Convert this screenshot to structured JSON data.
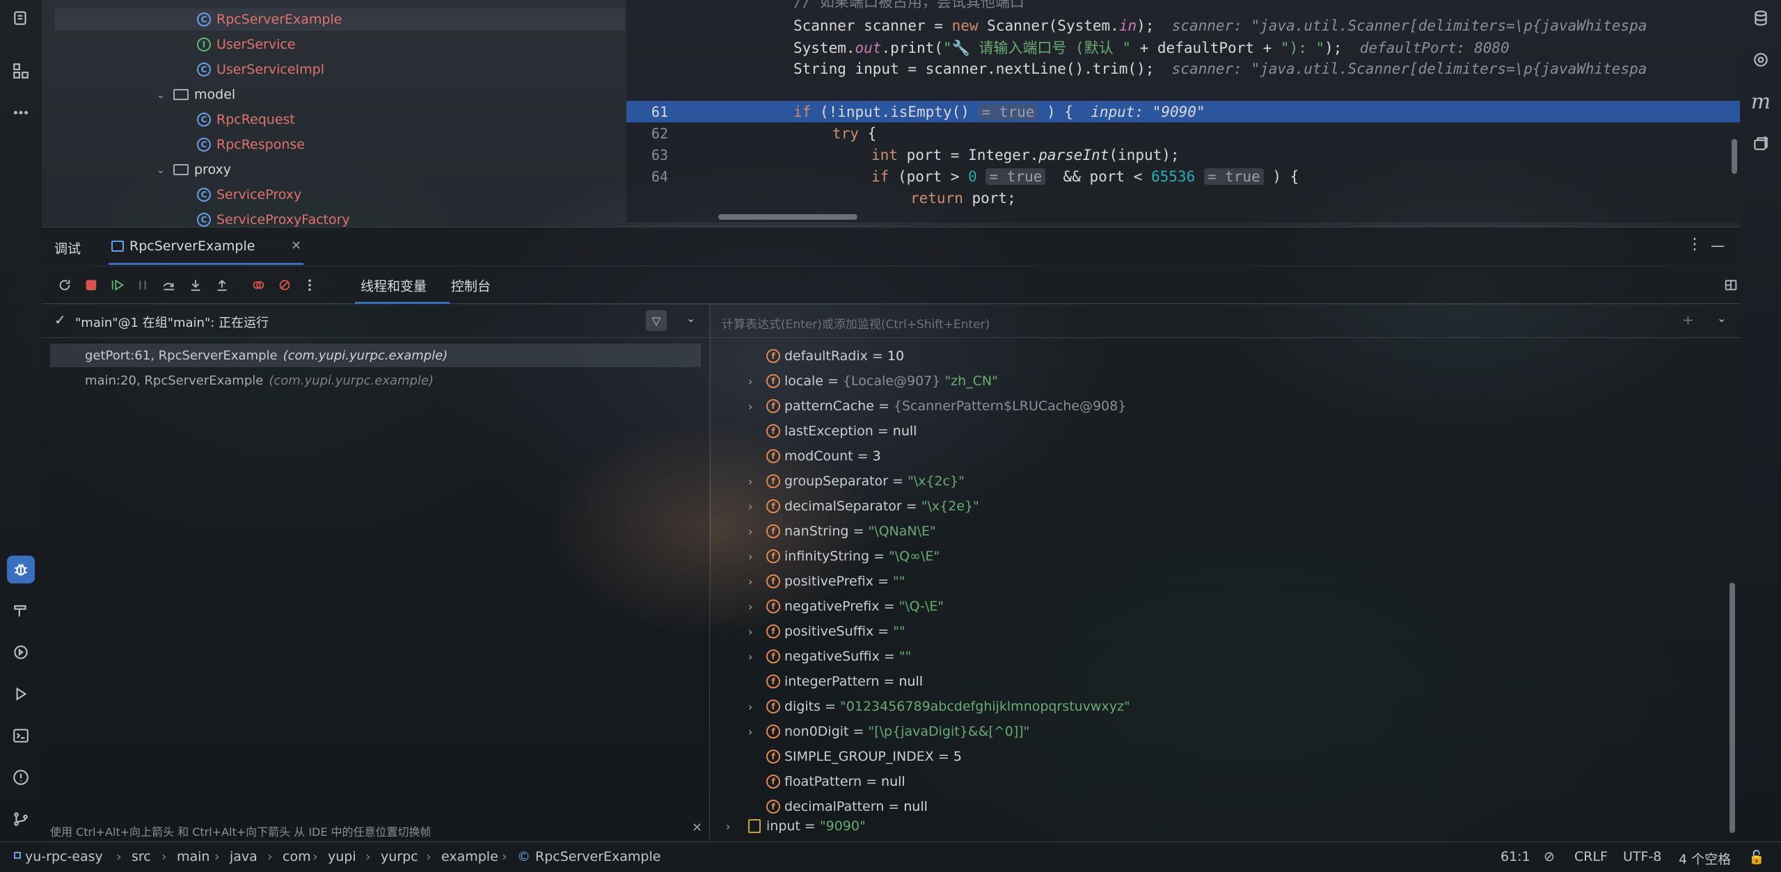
{
  "project_tree": {
    "items": [
      {
        "label": "RpcServerExample",
        "kind": "class",
        "color": "red",
        "selected": true
      },
      {
        "label": "UserService",
        "kind": "interface",
        "color": "red"
      },
      {
        "label": "UserServiceImpl",
        "kind": "class",
        "color": "red"
      },
      {
        "label": "model",
        "kind": "package"
      },
      {
        "label": "RpcRequest",
        "kind": "class",
        "color": "red"
      },
      {
        "label": "RpcResponse",
        "kind": "class",
        "color": "red"
      },
      {
        "label": "proxy",
        "kind": "package"
      },
      {
        "label": "ServiceProxy",
        "kind": "class",
        "color": "red"
      },
      {
        "label": "ServiceProxyFactory",
        "kind": "class",
        "color": "red"
      }
    ]
  },
  "editor": {
    "comment_top": "// 如果端口被占用，尝试其他端口",
    "lines": [
      {
        "num": "",
        "code": "Scanner scanner = new Scanner(System.in);",
        "inlay": "scanner: \"java.util.Scanner[delimiters=\\p{javaWhitespa"
      },
      {
        "num": "",
        "code": "System.out.print(\"🔧 请输入端口号 (默认 \" + defaultPort + \"): \");",
        "inlay": "defaultPort: 8080"
      },
      {
        "num": "",
        "code": "String input = scanner.nextLine().trim();",
        "inlay": "scanner: \"java.util.Scanner[delimiters=\\p{javaWhitespa"
      },
      {
        "num": "61",
        "code": "if (!input.isEmpty()",
        "box": "= true",
        "code2": ") {",
        "inlay": "input: \"9090\""
      },
      {
        "num": "62",
        "code": "try {"
      },
      {
        "num": "63",
        "code": "int port = Integer.parseInt(input);"
      },
      {
        "num": "64",
        "code": "if (port > 0",
        "box": "= true",
        "code2": "&& port < 65536",
        "box2": "= true",
        "code3": ") {"
      },
      {
        "num": "",
        "code": "return port;"
      }
    ]
  },
  "debug": {
    "tab_debug": "调试",
    "tab_config": "RpcServerExample",
    "tab_threads": "线程和变量",
    "tab_console": "控制台",
    "thread_status": "\"main\"@1 在组\"main\": 正在运行",
    "eval_placeholder": "计算表达式(Enter)或添加监视(Ctrl+Shift+Enter)",
    "frames": [
      {
        "method": "getPort:61, RpcServerExample",
        "ctx": "(com.yupi.yurpc.example)"
      },
      {
        "method": "main:20, RpcServerExample",
        "ctx": "(com.yupi.yurpc.example)"
      }
    ],
    "variables": [
      {
        "name": "defaultRadix",
        "value": "10",
        "type": "num",
        "expandable": false
      },
      {
        "name": "locale",
        "value": "\"zh_CN\"",
        "ref": "{Locale@907}",
        "type": "str",
        "expandable": true
      },
      {
        "name": "patternCache",
        "value": "",
        "ref": "{ScannerPattern$LRUCache@908}",
        "type": "ref",
        "expandable": true
      },
      {
        "name": "lastException",
        "value": "null",
        "type": "num",
        "expandable": false
      },
      {
        "name": "modCount",
        "value": "3",
        "type": "num",
        "expandable": false
      },
      {
        "name": "groupSeparator",
        "value": "\"\\x{2c}\"",
        "type": "str",
        "expandable": true
      },
      {
        "name": "decimalSeparator",
        "value": "\"\\x{2e}\"",
        "type": "str",
        "expandable": true
      },
      {
        "name": "nanString",
        "value": "\"\\QNaN\\E\"",
        "type": "str",
        "expandable": true
      },
      {
        "name": "infinityString",
        "value": "\"\\Q∞\\E\"",
        "type": "str",
        "expandable": true
      },
      {
        "name": "positivePrefix",
        "value": "\"\"",
        "type": "str",
        "expandable": true
      },
      {
        "name": "negativePrefix",
        "value": "\"\\Q-\\E\"",
        "type": "str",
        "expandable": true
      },
      {
        "name": "positiveSuffix",
        "value": "\"\"",
        "type": "str",
        "expandable": true
      },
      {
        "name": "negativeSuffix",
        "value": "\"\"",
        "type": "str",
        "expandable": true
      },
      {
        "name": "integerPattern",
        "value": "null",
        "type": "num",
        "expandable": false
      },
      {
        "name": "digits",
        "value": "\"0123456789abcdefghijklmnopqrstuvwxyz\"",
        "type": "str",
        "expandable": true
      },
      {
        "name": "non0Digit",
        "value": "\"[\\p{javaDigit}&&[^0]]\"",
        "type": "str",
        "expandable": true
      },
      {
        "name": "SIMPLE_GROUP_INDEX",
        "value": "5",
        "type": "num",
        "expandable": false
      },
      {
        "name": "floatPattern",
        "value": "null",
        "type": "num",
        "expandable": false
      },
      {
        "name": "decimalPattern",
        "value": "null",
        "type": "num",
        "expandable": false
      }
    ],
    "local_var": {
      "name": "input",
      "value": "\"9090\""
    }
  },
  "hint": "使用 Ctrl+Alt+向上箭头 和 Ctrl+Alt+向下箭头 从 IDE 中的任意位置切换帧",
  "statusbar": {
    "breadcrumb": [
      "yu-rpc-easy",
      "src",
      "main",
      "java",
      "com",
      "yupi",
      "yurpc",
      "example",
      "RpcServerExample"
    ],
    "position": "61:1",
    "line_sep": "CRLF",
    "encoding": "UTF-8",
    "indent": "4 个空格"
  },
  "colors": {
    "accent": "#3a6fbf",
    "highlight_line": "#2e5eb2",
    "string": "#6aab73",
    "keyword": "#cf8e6d",
    "field_icon": "#e08855"
  }
}
